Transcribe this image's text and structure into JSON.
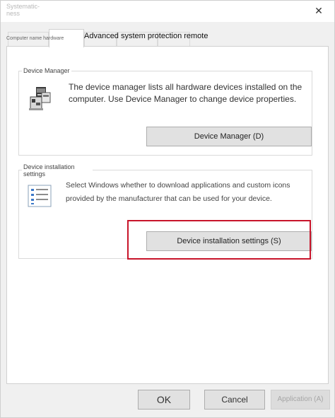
{
  "window": {
    "title": "Systematic-ness",
    "close_glyph": "✕"
  },
  "tabs": {
    "active_label": "Computer name hardware",
    "remote_label": "Advanced system protection remote"
  },
  "device_manager": {
    "legend": "Device Manager",
    "description": "The device manager lists all hardware devices installed on the computer. Use Device Manager to change device properties.",
    "button_label": "Device Manager (D)",
    "icon": "device-manager-icon"
  },
  "device_installation": {
    "legend": "Device installation settings",
    "description": "Select Windows whether to download applications and custom icons provided by the manufacturer that can be used for your device.",
    "button_label": "Device installation settings (S)",
    "icon": "checklist-icon",
    "highlight_color": "#c8142a"
  },
  "footer": {
    "ok_label": "OK",
    "cancel_label": "Cancel",
    "apply_label": "Application (A)"
  }
}
